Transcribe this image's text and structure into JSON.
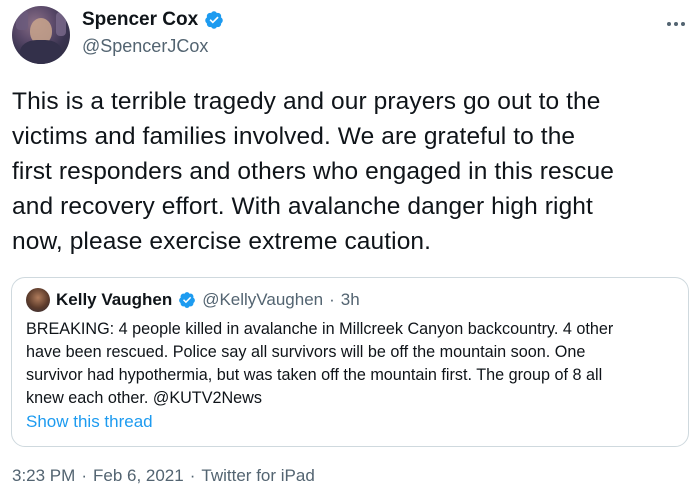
{
  "tweet": {
    "author_name": "Spencer Cox",
    "author_handle": "@SpencerJCox",
    "text_lines": [
      "This is a terrible tragedy and our prayers go out to the",
      "victims and families involved. We are grateful to the",
      "first responders and others who engaged in this rescue",
      "and recovery effort. With avalanche danger high right",
      "now, please exercise extreme caution."
    ],
    "timestamp": "3:23 PM",
    "separator": "·",
    "date": "Feb 6, 2021",
    "client": "Twitter for iPad"
  },
  "quoted": {
    "author_name": "Kelly Vaughen",
    "author_handle": "@KellyVaughen",
    "separator": "·",
    "time_ago": "3h",
    "text_lines": [
      "BREAKING: 4 people killed in avalanche in Millcreek Canyon backcountry. 4 other",
      "have been rescued. Police say all survivors will be off the mountain soon. One",
      "survivor had hypothermia, but was taken off the mountain first. The group of 8 all",
      "knew each other. @KUTV2News"
    ],
    "show_thread_label": "Show this thread"
  },
  "icons": {
    "verified": "verified-badge-icon",
    "more": "more-options-icon"
  },
  "colors": {
    "verified_blue": "#1d9bf0",
    "link_blue": "#1d9bf0",
    "secondary_text": "#536471",
    "border": "#cfd9de"
  }
}
